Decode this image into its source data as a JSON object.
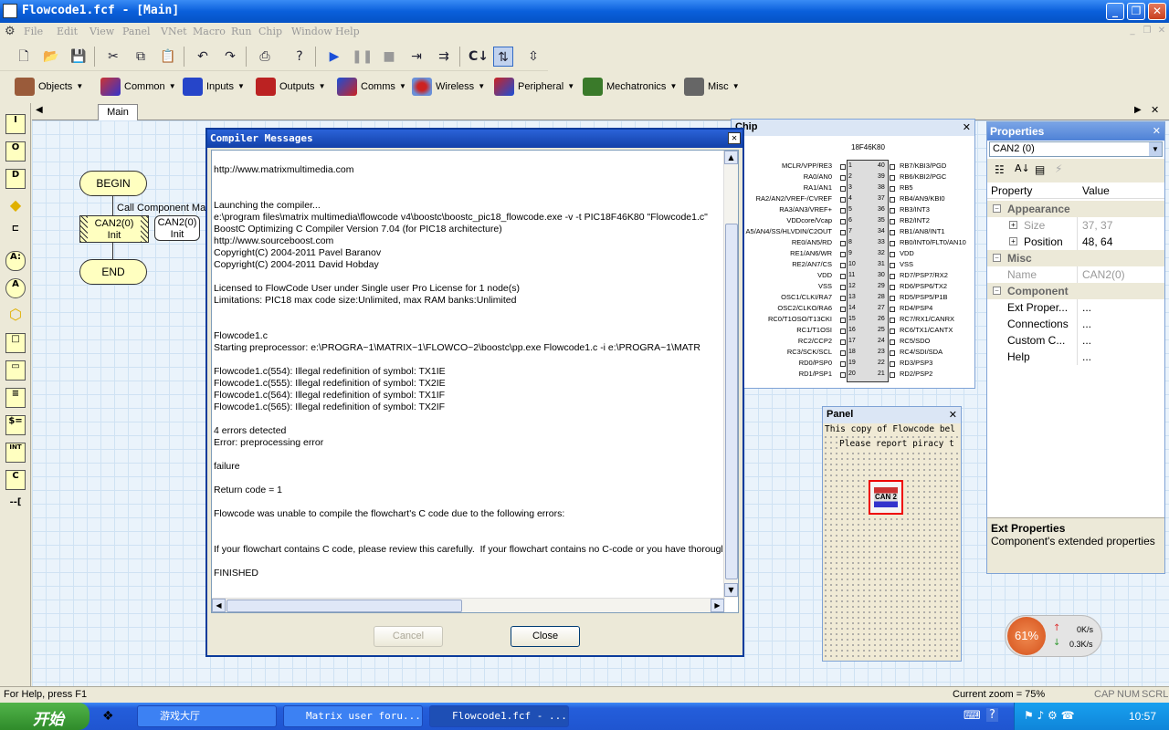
{
  "window": {
    "title": "Flowcode1.fcf - [Main]"
  },
  "menu": [
    "File",
    "Edit",
    "View",
    "Panel",
    "VNet",
    "Macro",
    "Run",
    "Chip",
    "Window",
    "Help"
  ],
  "categories": [
    "Objects",
    "Common",
    "Inputs",
    "Outputs",
    "Comms",
    "Wireless",
    "Peripheral",
    "Mechatronics",
    "Misc"
  ],
  "palette": [
    "I",
    "O",
    "D",
    "◆",
    "⊏",
    "A:",
    "A",
    "⬡",
    "□",
    "▭",
    "≡",
    "$=",
    "INT",
    "C",
    "--["
  ],
  "tab": "Main",
  "flowchart": {
    "begin": "BEGIN",
    "end": "END",
    "macro_label": "Call Component Mac",
    "call_line1": "CAN2(0)",
    "call_line2": "Init",
    "tip_line1": "CAN2(0)",
    "tip_line2": "Init"
  },
  "dialog": {
    "title": "Compiler Messages",
    "messages": "\nhttp://www.matrixmultimedia.com\n\n\nLaunching the compiler...\ne:\\program files\\matrix multimedia\\flowcode v4\\boostc\\boostc_pic18_flowcode.exe -v -t PIC18F46K80 \"Flowcode1.c\"\nBoostC Optimizing C Compiler Version 7.04 (for PIC18 architecture)\nhttp://www.sourceboost.com\nCopyright(C) 2004-2011 Pavel Baranov\nCopyright(C) 2004-2011 David Hobday\n\nLicensed to FlowCode User under Single user Pro License for 1 node(s)\nLimitations: PIC18 max code size:Unlimited, max RAM banks:Unlimited\n\n\nFlowcode1.c\nStarting preprocessor: e:\\PROGRA~1\\MATRIX~1\\FLOWCO~2\\boostc\\pp.exe Flowcode1.c -i e:\\PROGRA~1\\MATR\n\nFlowcode1.c(554): Illegal redefinition of symbol: TX1IE\nFlowcode1.c(555): Illegal redefinition of symbol: TX2IE\nFlowcode1.c(564): Illegal redefinition of symbol: TX1IF\nFlowcode1.c(565): Illegal redefinition of symbol: TX2IF\n\n4 errors detected\nError: preprocessing error\n\nfailure\n\nReturn code = 1\n\nFlowcode was unable to compile the flowchart's C code due to the following errors:\n\n\nIf your flowchart contains C code, please review this carefully.  If your flowchart contains no C-code or you have thorougl\n\nFINISHED",
    "cancel": "Cancel",
    "close": "Close"
  },
  "chip": {
    "title": "Chip",
    "name": "18F46K80",
    "left_pins": [
      "MCLR/VPP/RE3",
      "RA0/AN0",
      "RA1/AN1",
      "RA2/AN2/VREF-/CVREF",
      "RA3/AN3/VREF+",
      "VDDcore/Vcap",
      "A5/AN4/SS/HLVDIN/C2OUT",
      "RE0/AN5/RD",
      "RE1/AN6/WR",
      "RE2/AN7/CS",
      "VDD",
      "VSS",
      "OSC1/CLKI/RA7",
      "OSC2/CLKO/RA6",
      "RC0/T1OSO/T13CKI",
      "RC1/T1OSI",
      "RC2/CCP2",
      "RC3/SCK/SCL",
      "RD0/PSP0",
      "RD1/PSP1"
    ],
    "right_pins": [
      "RB7/KBI3/PGD",
      "RB6/KBI2/PGC",
      "RB5",
      "RB4/AN9/KBI0",
      "RB3/INT3",
      "RB2/INT2",
      "RB1/AN8/INT1",
      "RB0/INT0/FLT0/AN10",
      "VDD",
      "VSS",
      "RD7/PSP7/RX2",
      "RD6/PSP6/TX2",
      "RD5/PSP5/P1B",
      "RD4/PSP4",
      "RC7/RX1/CANRX",
      "RC6/TX1/CANTX",
      "RC5/SDO",
      "RC4/SDI/SDA",
      "RD3/PSP3",
      "RD2/PSP2"
    ]
  },
  "panel": {
    "title": "Panel",
    "line1": "This copy of Flowcode bel",
    "line2": "Please report piracy t",
    "component": "CAN 2"
  },
  "properties": {
    "title": "Properties",
    "selected": "CAN2 (0)",
    "col_property": "Property",
    "col_value": "Value",
    "rows": [
      {
        "type": "cat",
        "k": "Appearance"
      },
      {
        "type": "sub",
        "k": "Size",
        "v": "37, 37",
        "dim": true
      },
      {
        "type": "sub",
        "k": "Position",
        "v": "48, 64",
        "dim": false
      },
      {
        "type": "cat",
        "k": "Misc"
      },
      {
        "type": "row",
        "k": "Name",
        "v": "CAN2(0)",
        "dim": true
      },
      {
        "type": "cat",
        "k": "Component"
      },
      {
        "type": "row",
        "k": "Ext Proper...",
        "v": "...",
        "dim": false
      },
      {
        "type": "row",
        "k": "Connections",
        "v": "...",
        "dim": false
      },
      {
        "type": "row",
        "k": "Custom C...",
        "v": "...",
        "dim": false
      },
      {
        "type": "row",
        "k": "Help",
        "v": "...",
        "dim": false
      }
    ],
    "desc_title": "Ext Properties",
    "desc_text": "Component's extended properties"
  },
  "netmeter": {
    "percent": "61%",
    "up": "0K/s",
    "down": "0.3K/s"
  },
  "status": {
    "help": "For Help, press F1",
    "zoom": "Current zoom = 75%",
    "cap": "CAP",
    "num": "NUM",
    "scrl": "SCRL"
  },
  "taskbar": {
    "start": "开始",
    "tasks": [
      "游戏大厅",
      "Matrix user foru...",
      "Flowcode1.fcf - ..."
    ],
    "clock": "10:57"
  }
}
